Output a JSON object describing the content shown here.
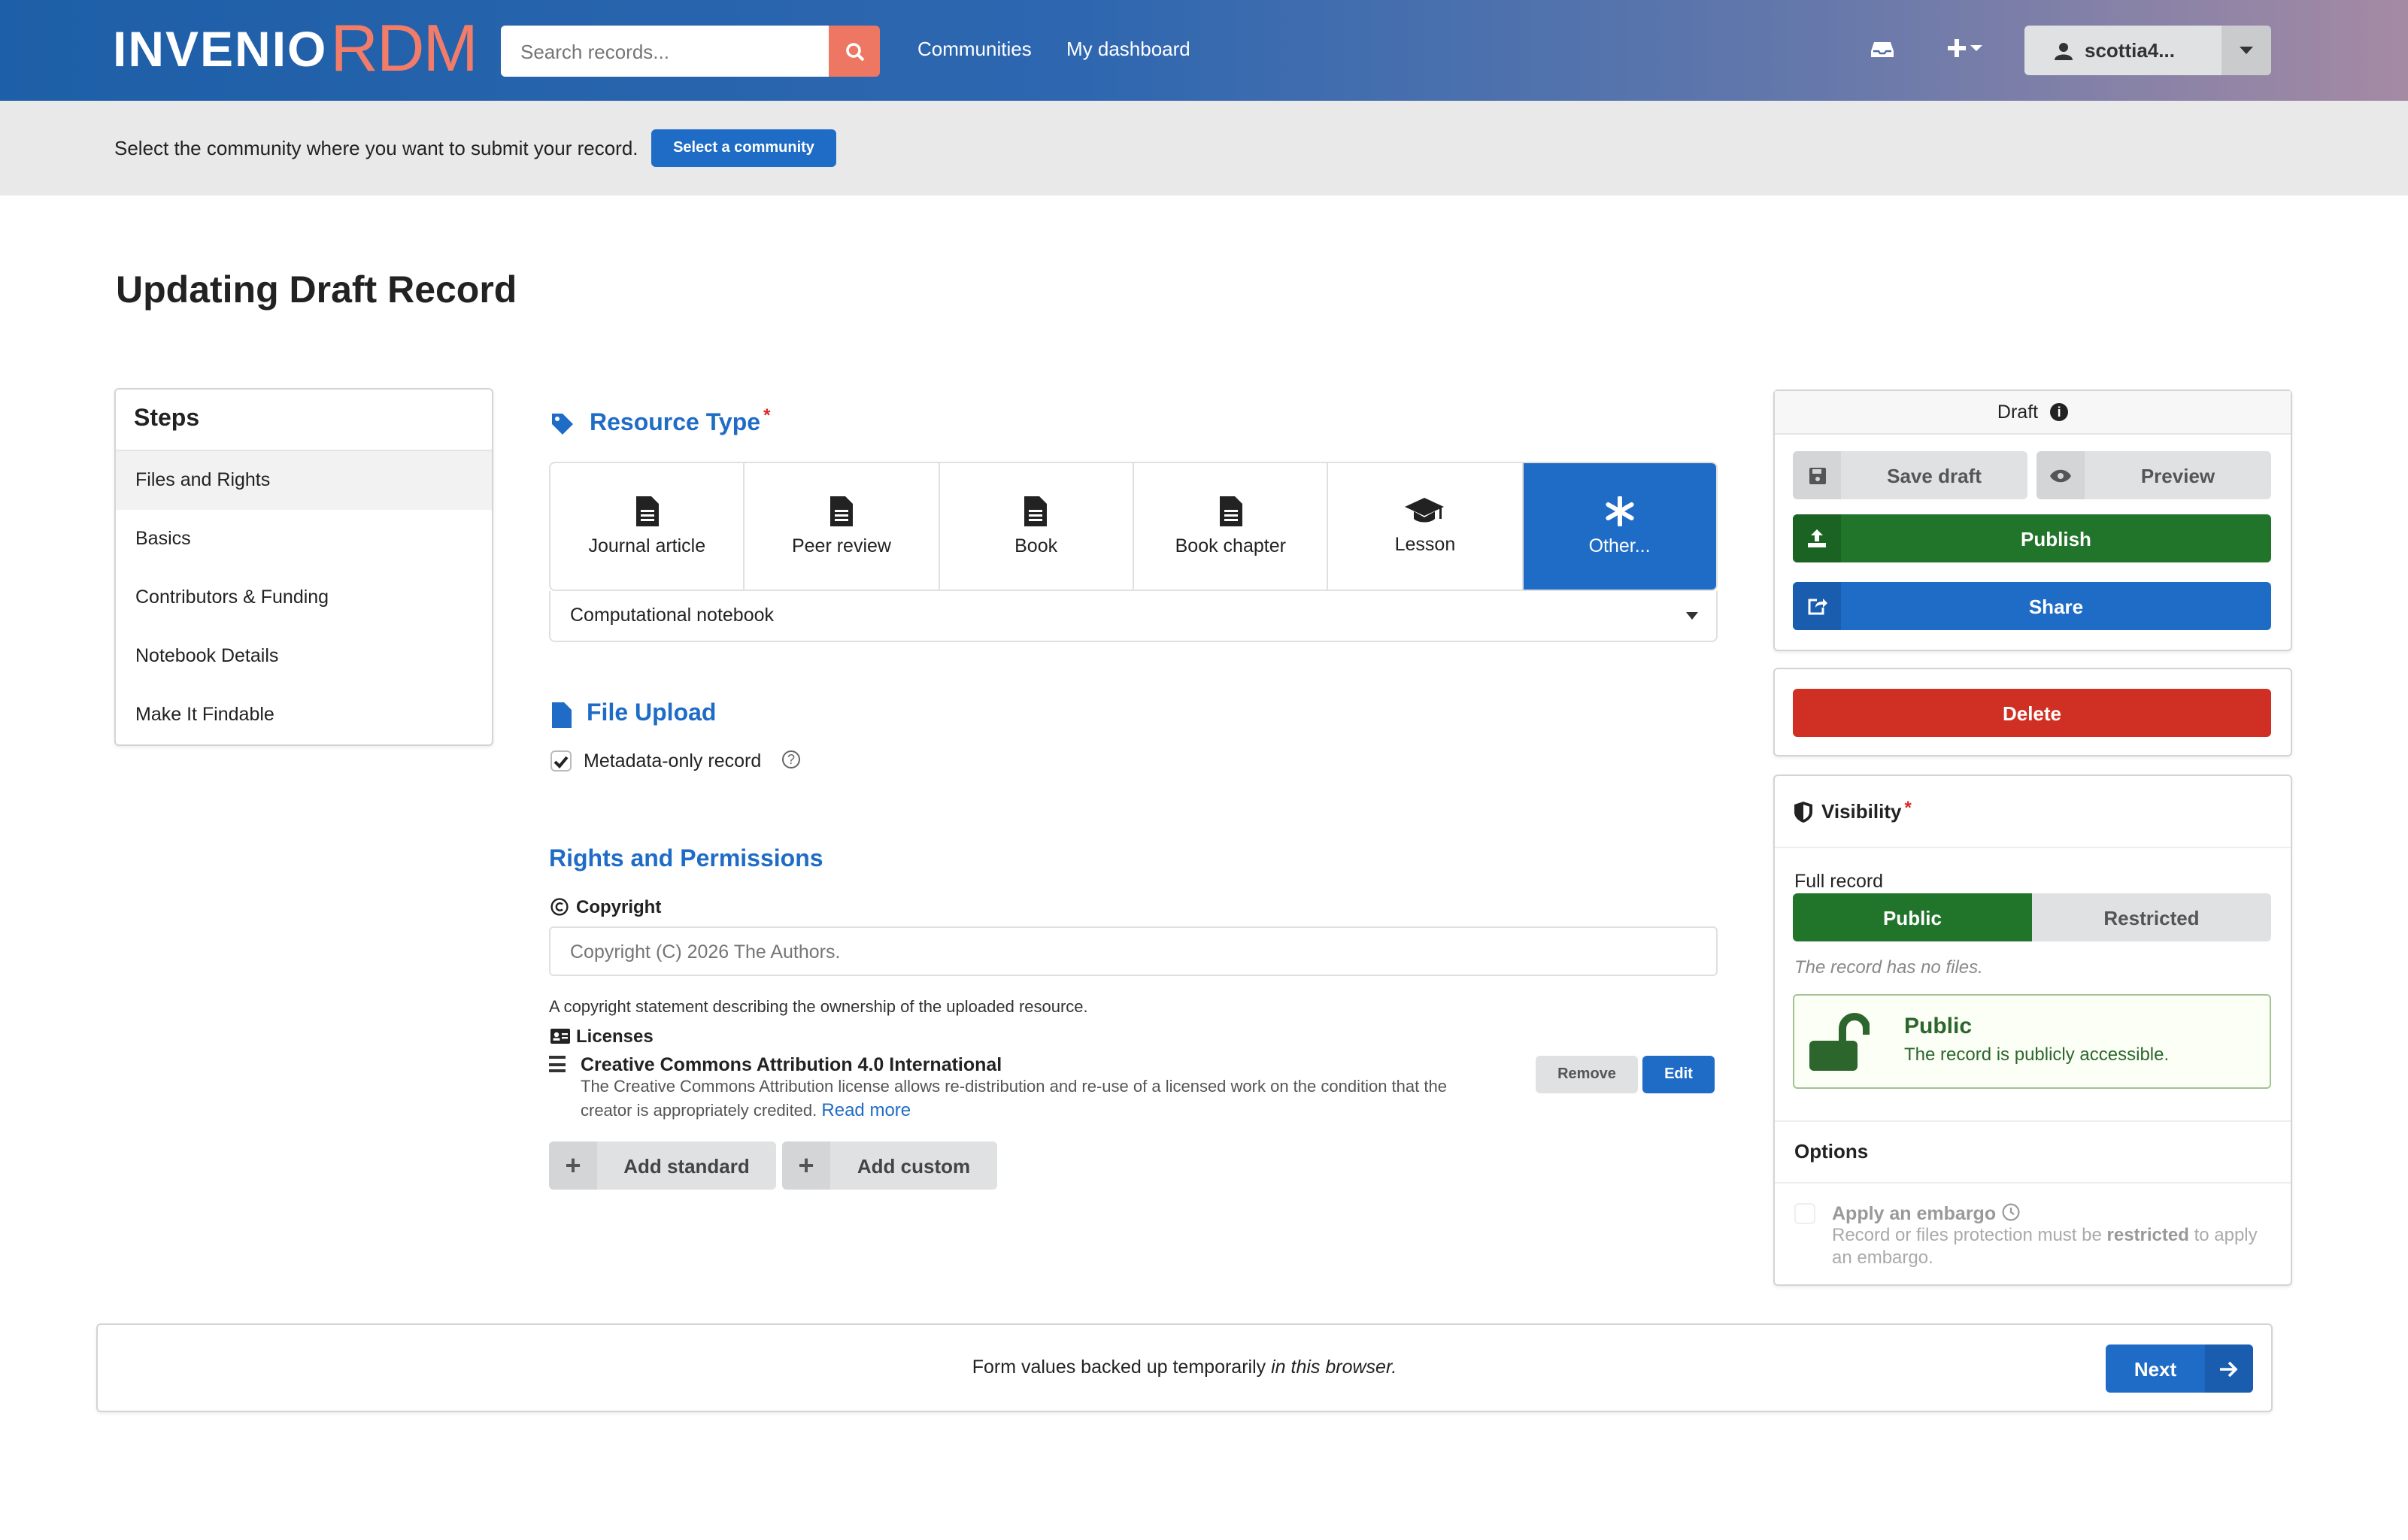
{
  "header": {
    "logo_invenio": "INVENIO",
    "logo_rdm": "RDM",
    "search_placeholder": "Search records...",
    "nav": [
      "Communities",
      "My dashboard"
    ],
    "user": "scottia4..."
  },
  "banner": {
    "text": "Select the community where you want to submit your record.",
    "button": "Select a community"
  },
  "page_title": "Updating Draft Record",
  "steps": {
    "title": "Steps",
    "items": [
      "Files and Rights",
      "Basics",
      "Contributors & Funding",
      "Notebook Details",
      "Make It Findable"
    ],
    "active": "Files and Rights"
  },
  "resource_type": {
    "title": "Resource Type",
    "options": [
      "Journal article",
      "Peer review",
      "Book",
      "Book chapter",
      "Lesson",
      "Other..."
    ],
    "selected": "Other...",
    "dropdown_value": "Computational notebook"
  },
  "file_upload": {
    "title": "File Upload",
    "metadata_only_label": "Metadata-only record",
    "metadata_only_checked": true
  },
  "rights": {
    "title": "Rights and Permissions",
    "copyright_label": "Copyright",
    "copyright_placeholder": "Copyright (C) 2026 The Authors.",
    "copyright_help": "A copyright statement describing the ownership of the uploaded resource.",
    "licenses_label": "Licenses",
    "license": {
      "title": "Creative Commons Attribution 4.0 International",
      "description": "The Creative Commons Attribution license allows re-distribution and re-use of a licensed work on the condition that the creator is appropriately credited.",
      "read_more": "Read more",
      "remove": "Remove",
      "edit": "Edit"
    },
    "add_standard": "Add standard",
    "add_custom": "Add custom"
  },
  "actions": {
    "status": "Draft",
    "save_draft": "Save draft",
    "preview": "Preview",
    "publish": "Publish",
    "share": "Share",
    "delete": "Delete"
  },
  "visibility": {
    "title": "Visibility",
    "full_record_label": "Full record",
    "public": "Public",
    "restricted": "Restricted",
    "selected": "Public",
    "no_files": "The record has no files.",
    "status_title": "Public",
    "status_text": "The record is publicly accessible.",
    "options_title": "Options",
    "embargo_title": "Apply an embargo",
    "embargo_desc_pre": "Record or files protection must be ",
    "embargo_desc_bold": "restricted",
    "embargo_desc_post": " to apply an embargo."
  },
  "footer": {
    "text_pre": "Form values backed up temporarily ",
    "text_em": "in this browser.",
    "next": "Next"
  },
  "colors": {
    "brand_blue": "#1f6cc6",
    "accent_salmon": "#ee7764",
    "publish_green": "#21752a",
    "delete_red": "#d03024"
  }
}
